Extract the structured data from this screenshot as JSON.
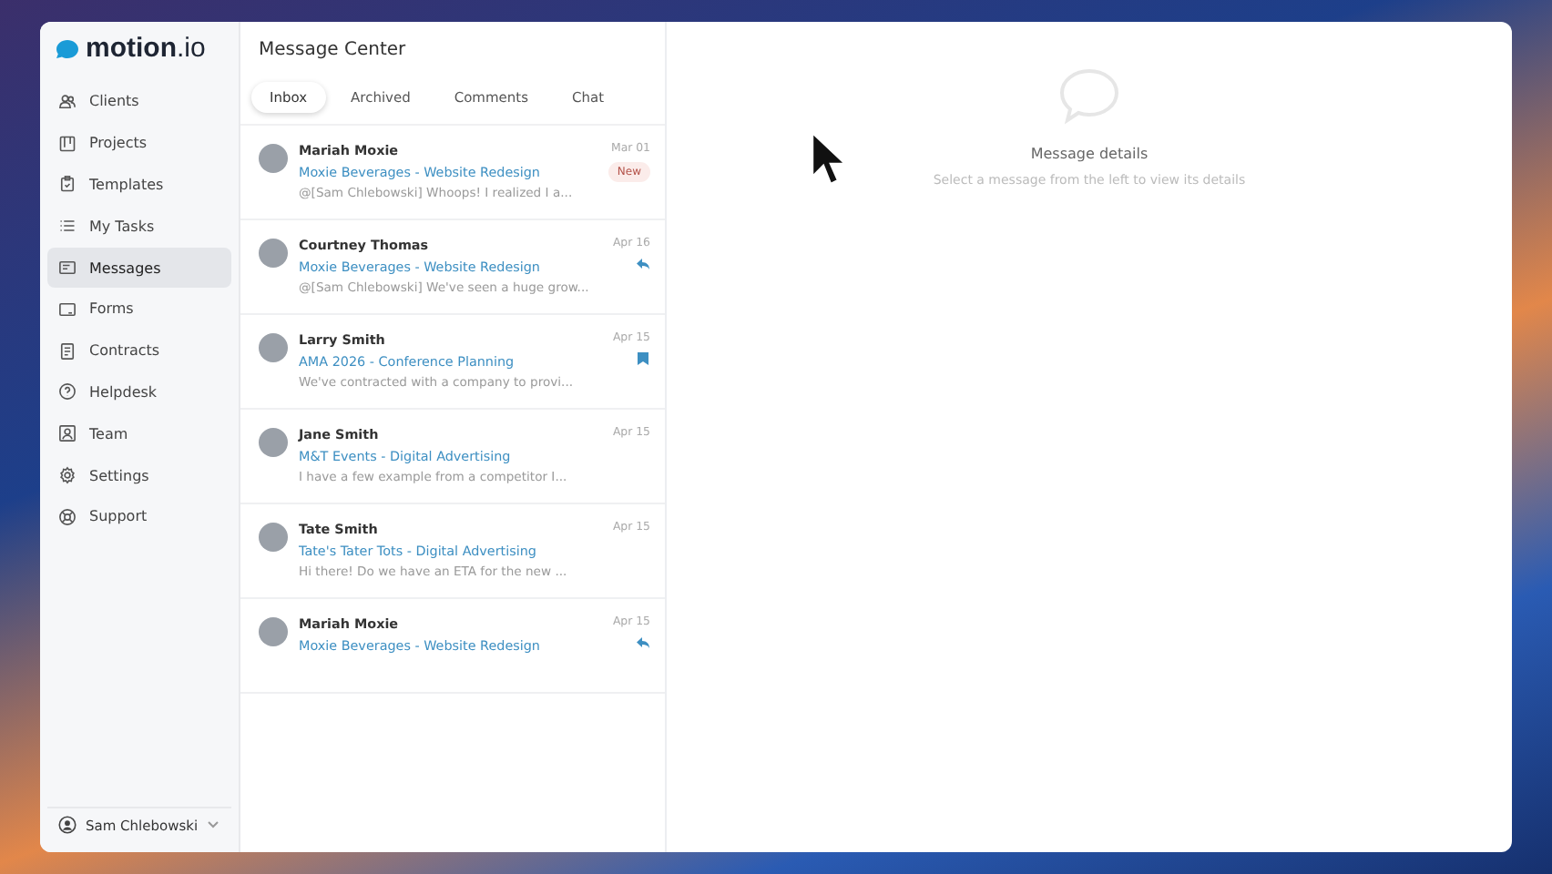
{
  "brand": {
    "name": "motion",
    "suffix": ".io"
  },
  "sidebar": {
    "items": [
      {
        "label": "Clients",
        "kind": "people",
        "selected": false
      },
      {
        "label": "Projects",
        "kind": "board",
        "selected": false
      },
      {
        "label": "Templates",
        "kind": "clipboard",
        "selected": false
      },
      {
        "label": "My Tasks",
        "kind": "list",
        "selected": false
      },
      {
        "label": "Messages",
        "kind": "message",
        "selected": true
      },
      {
        "label": "Forms",
        "kind": "form",
        "selected": false
      },
      {
        "label": "Contracts",
        "kind": "document",
        "selected": false
      },
      {
        "label": "Helpdesk",
        "kind": "question",
        "selected": false
      },
      {
        "label": "Team",
        "kind": "person",
        "selected": false
      },
      {
        "label": "Settings",
        "kind": "gear",
        "selected": false
      },
      {
        "label": "Support",
        "kind": "lifebuoy",
        "selected": false
      }
    ],
    "user": "Sam Chlebowski"
  },
  "message_center": {
    "title": "Message Center",
    "tabs": [
      {
        "label": "Inbox",
        "selected": true
      },
      {
        "label": "Archived",
        "selected": false
      },
      {
        "label": "Comments",
        "selected": false
      },
      {
        "label": "Chat",
        "selected": false
      }
    ],
    "messages": [
      {
        "sender": "Mariah Moxie",
        "project": "Moxie Beverages - Website Redesign",
        "preview": "@[Sam Chlebowski] Whoops! I realized I a...",
        "date": "Mar 01",
        "kind": "badge",
        "badge": "New"
      },
      {
        "sender": "Courtney Thomas",
        "project": "Moxie Beverages - Website Redesign",
        "preview": "@[Sam Chlebowski] We've seen a huge grow...",
        "date": "Apr 16",
        "kind": "reply"
      },
      {
        "sender": "Larry Smith",
        "project": "AMA 2026 - Conference Planning",
        "preview": "We've contracted with a company to provi...",
        "date": "Apr 15",
        "kind": "flag"
      },
      {
        "sender": "Jane Smith",
        "project": "M&T Events - Digital Advertising",
        "preview": "I have a few example from a competitor I...",
        "date": "Apr 15",
        "kind": "plain"
      },
      {
        "sender": "Tate Smith",
        "project": "Tate's Tater Tots - Digital Advertising",
        "preview": "Hi there! Do we have an ETA for the new ...",
        "date": "Apr 15",
        "kind": "plain"
      },
      {
        "sender": "Mariah Moxie",
        "project": "Moxie Beverages - Website Redesign",
        "date": "Apr 15",
        "kind": "reply"
      }
    ]
  },
  "details": {
    "title": "Message details",
    "hint": "Select a message from the left to view its details"
  }
}
